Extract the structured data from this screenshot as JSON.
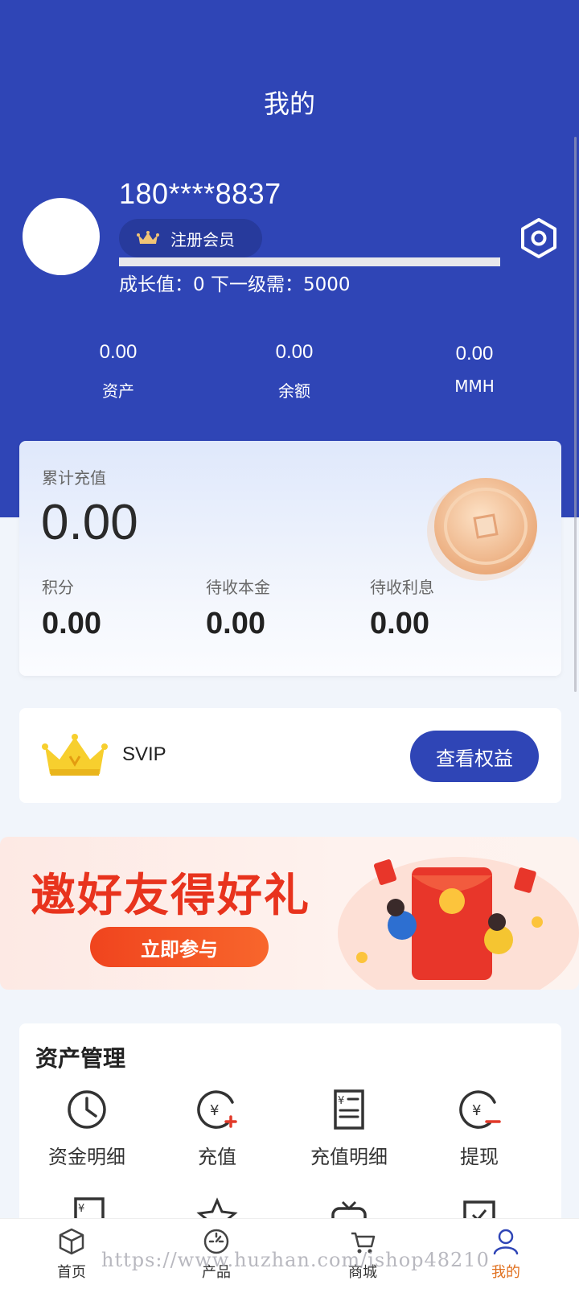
{
  "header": {
    "title": "我的"
  },
  "profile": {
    "phone": "180****8837",
    "member_level": "注册会员",
    "growth_text": "成长值：0 下一级需：5000",
    "growth_progress": 0
  },
  "stats": [
    {
      "value": "0.00",
      "label": "资产"
    },
    {
      "value": "0.00",
      "label": "余额"
    },
    {
      "value": "0.00",
      "label": "MMH"
    }
  ],
  "recharge_card": {
    "total_label": "累计充值",
    "total_value": "0.00",
    "items": [
      {
        "label": "积分",
        "value": "0.00"
      },
      {
        "label": "待收本金",
        "value": "0.00"
      },
      {
        "label": "待收利息",
        "value": "0.00"
      }
    ]
  },
  "vip": {
    "label": "SVIP",
    "button": "查看权益"
  },
  "banner": {
    "headline": "邀好友得好礼",
    "button": "立即参与"
  },
  "asset_management": {
    "title": "资产管理",
    "items": [
      {
        "label": "资金明细",
        "icon": "clock-pie-icon"
      },
      {
        "label": "充值",
        "icon": "yuan-plus-icon"
      },
      {
        "label": "充值明细",
        "icon": "receipt-icon"
      },
      {
        "label": "提现",
        "icon": "yuan-minus-icon"
      }
    ]
  },
  "tabbar": {
    "items": [
      {
        "label": "首页",
        "icon": "box-icon"
      },
      {
        "label": "产品",
        "icon": "gauge-icon"
      },
      {
        "label": "商城",
        "icon": "cart-icon"
      },
      {
        "label": "我的",
        "icon": "user-icon",
        "active": true
      }
    ]
  },
  "watermark": "https://www.huzhan.com/ishop48210",
  "colors": {
    "primary": "#2f45b6",
    "accent": "#e0701f",
    "banner_red": "#e8331d"
  }
}
